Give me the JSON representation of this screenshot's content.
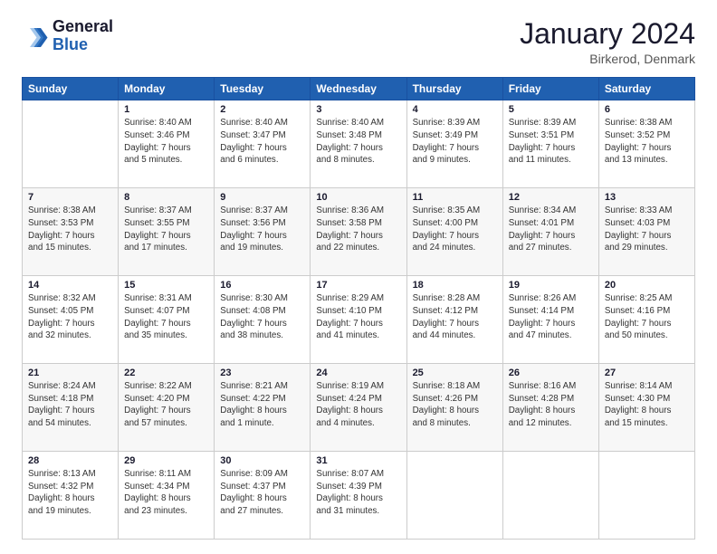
{
  "header": {
    "logo_general": "General",
    "logo_blue": "Blue",
    "month_title": "January 2024",
    "location": "Birkerod, Denmark"
  },
  "weekdays": [
    "Sunday",
    "Monday",
    "Tuesday",
    "Wednesday",
    "Thursday",
    "Friday",
    "Saturday"
  ],
  "weeks": [
    [
      {
        "day": "",
        "info": ""
      },
      {
        "day": "1",
        "info": "Sunrise: 8:40 AM\nSunset: 3:46 PM\nDaylight: 7 hours\nand 5 minutes."
      },
      {
        "day": "2",
        "info": "Sunrise: 8:40 AM\nSunset: 3:47 PM\nDaylight: 7 hours\nand 6 minutes."
      },
      {
        "day": "3",
        "info": "Sunrise: 8:40 AM\nSunset: 3:48 PM\nDaylight: 7 hours\nand 8 minutes."
      },
      {
        "day": "4",
        "info": "Sunrise: 8:39 AM\nSunset: 3:49 PM\nDaylight: 7 hours\nand 9 minutes."
      },
      {
        "day": "5",
        "info": "Sunrise: 8:39 AM\nSunset: 3:51 PM\nDaylight: 7 hours\nand 11 minutes."
      },
      {
        "day": "6",
        "info": "Sunrise: 8:38 AM\nSunset: 3:52 PM\nDaylight: 7 hours\nand 13 minutes."
      }
    ],
    [
      {
        "day": "7",
        "info": "Sunrise: 8:38 AM\nSunset: 3:53 PM\nDaylight: 7 hours\nand 15 minutes."
      },
      {
        "day": "8",
        "info": "Sunrise: 8:37 AM\nSunset: 3:55 PM\nDaylight: 7 hours\nand 17 minutes."
      },
      {
        "day": "9",
        "info": "Sunrise: 8:37 AM\nSunset: 3:56 PM\nDaylight: 7 hours\nand 19 minutes."
      },
      {
        "day": "10",
        "info": "Sunrise: 8:36 AM\nSunset: 3:58 PM\nDaylight: 7 hours\nand 22 minutes."
      },
      {
        "day": "11",
        "info": "Sunrise: 8:35 AM\nSunset: 4:00 PM\nDaylight: 7 hours\nand 24 minutes."
      },
      {
        "day": "12",
        "info": "Sunrise: 8:34 AM\nSunset: 4:01 PM\nDaylight: 7 hours\nand 27 minutes."
      },
      {
        "day": "13",
        "info": "Sunrise: 8:33 AM\nSunset: 4:03 PM\nDaylight: 7 hours\nand 29 minutes."
      }
    ],
    [
      {
        "day": "14",
        "info": "Sunrise: 8:32 AM\nSunset: 4:05 PM\nDaylight: 7 hours\nand 32 minutes."
      },
      {
        "day": "15",
        "info": "Sunrise: 8:31 AM\nSunset: 4:07 PM\nDaylight: 7 hours\nand 35 minutes."
      },
      {
        "day": "16",
        "info": "Sunrise: 8:30 AM\nSunset: 4:08 PM\nDaylight: 7 hours\nand 38 minutes."
      },
      {
        "day": "17",
        "info": "Sunrise: 8:29 AM\nSunset: 4:10 PM\nDaylight: 7 hours\nand 41 minutes."
      },
      {
        "day": "18",
        "info": "Sunrise: 8:28 AM\nSunset: 4:12 PM\nDaylight: 7 hours\nand 44 minutes."
      },
      {
        "day": "19",
        "info": "Sunrise: 8:26 AM\nSunset: 4:14 PM\nDaylight: 7 hours\nand 47 minutes."
      },
      {
        "day": "20",
        "info": "Sunrise: 8:25 AM\nSunset: 4:16 PM\nDaylight: 7 hours\nand 50 minutes."
      }
    ],
    [
      {
        "day": "21",
        "info": "Sunrise: 8:24 AM\nSunset: 4:18 PM\nDaylight: 7 hours\nand 54 minutes."
      },
      {
        "day": "22",
        "info": "Sunrise: 8:22 AM\nSunset: 4:20 PM\nDaylight: 7 hours\nand 57 minutes."
      },
      {
        "day": "23",
        "info": "Sunrise: 8:21 AM\nSunset: 4:22 PM\nDaylight: 8 hours\nand 1 minute."
      },
      {
        "day": "24",
        "info": "Sunrise: 8:19 AM\nSunset: 4:24 PM\nDaylight: 8 hours\nand 4 minutes."
      },
      {
        "day": "25",
        "info": "Sunrise: 8:18 AM\nSunset: 4:26 PM\nDaylight: 8 hours\nand 8 minutes."
      },
      {
        "day": "26",
        "info": "Sunrise: 8:16 AM\nSunset: 4:28 PM\nDaylight: 8 hours\nand 12 minutes."
      },
      {
        "day": "27",
        "info": "Sunrise: 8:14 AM\nSunset: 4:30 PM\nDaylight: 8 hours\nand 15 minutes."
      }
    ],
    [
      {
        "day": "28",
        "info": "Sunrise: 8:13 AM\nSunset: 4:32 PM\nDaylight: 8 hours\nand 19 minutes."
      },
      {
        "day": "29",
        "info": "Sunrise: 8:11 AM\nSunset: 4:34 PM\nDaylight: 8 hours\nand 23 minutes."
      },
      {
        "day": "30",
        "info": "Sunrise: 8:09 AM\nSunset: 4:37 PM\nDaylight: 8 hours\nand 27 minutes."
      },
      {
        "day": "31",
        "info": "Sunrise: 8:07 AM\nSunset: 4:39 PM\nDaylight: 8 hours\nand 31 minutes."
      },
      {
        "day": "",
        "info": ""
      },
      {
        "day": "",
        "info": ""
      },
      {
        "day": "",
        "info": ""
      }
    ]
  ]
}
